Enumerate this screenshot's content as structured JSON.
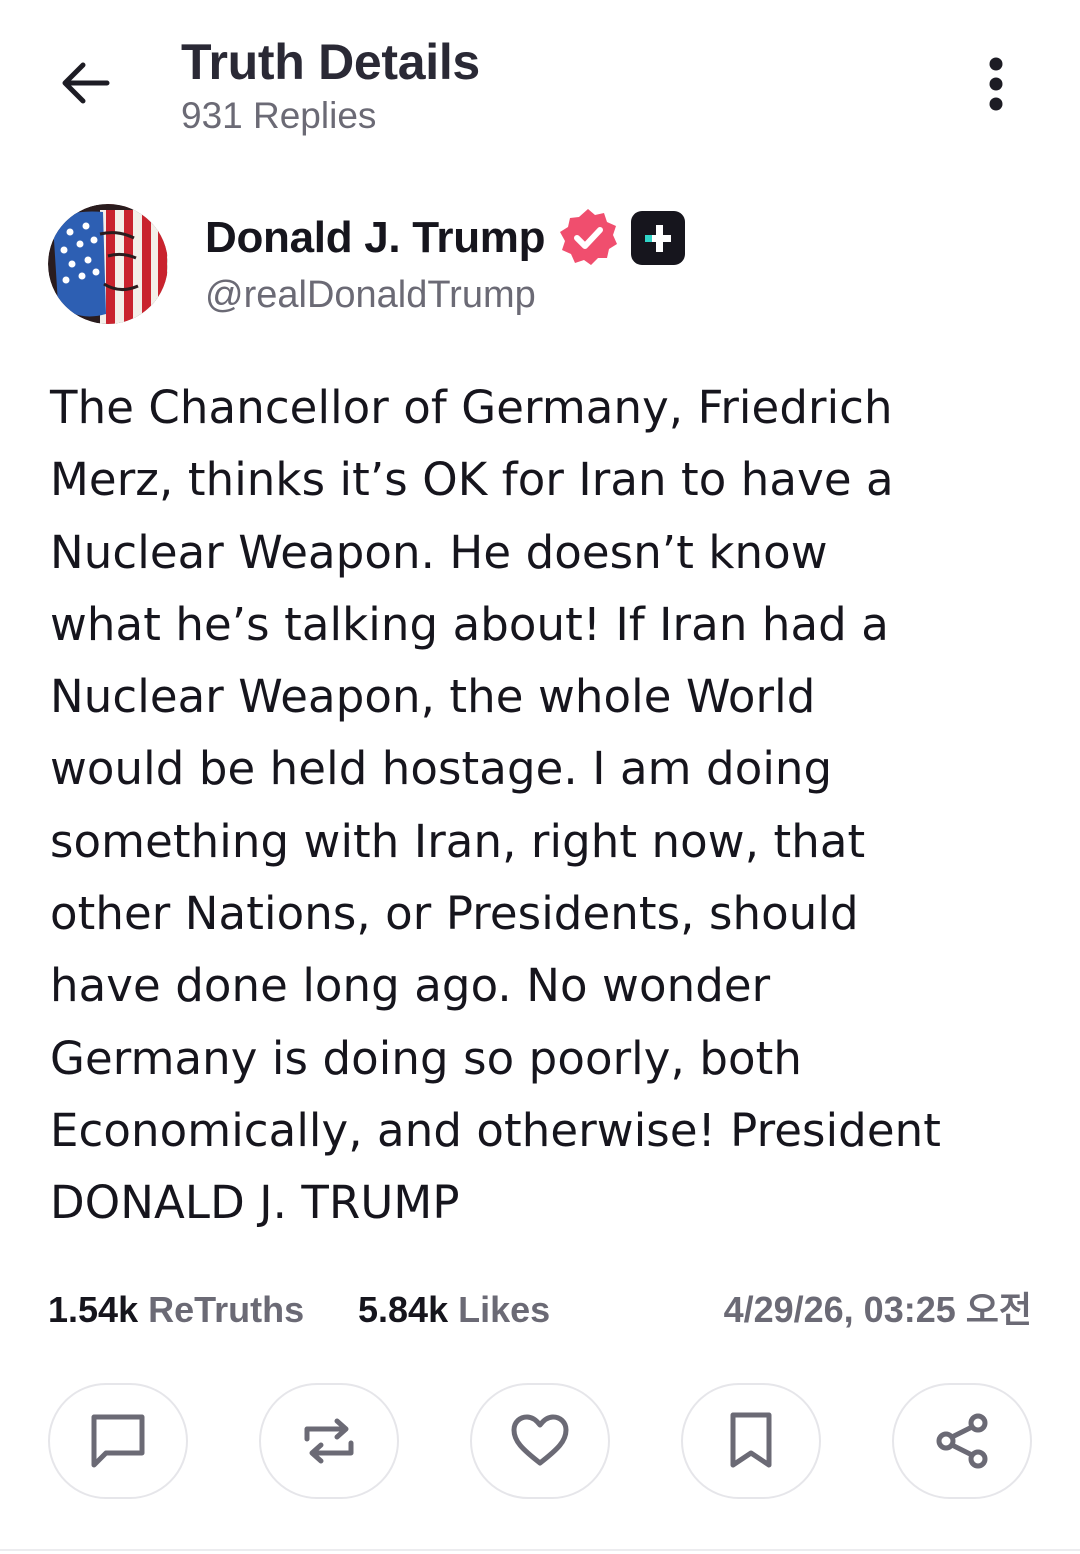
{
  "header": {
    "title": "Truth Details",
    "replies": "931 Replies"
  },
  "author": {
    "display_name": "Donald J. Trump",
    "handle": "@realDonaldTrump",
    "verified_color": "#f04e6e",
    "plus_badge_color": "#16151d",
    "plus_accent_color": "#30d5c8"
  },
  "post": {
    "text": "The Chancellor of Germany, Friedrich\nMerz, thinks it’s OK for Iran to have a\nNuclear Weapon. He doesn’t know\nwhat he’s talking about! If Iran had a\nNuclear Weapon, the whole World\nwould be held hostage. I am doing\nsomething with Iran, right now, that\nother Nations, or Presidents, should\nhave done long ago. No wonder\nGermany is doing so poorly, both\nEconomically, and otherwise! President\nDONALD J. TRUMP"
  },
  "stats": {
    "retruths_count": "1.54k",
    "retruths_label": "ReTruths",
    "likes_count": "5.84k",
    "likes_label": "Likes",
    "timestamp": "4/29/26, 03:25 오전"
  },
  "actions": {
    "icons": [
      "reply-icon",
      "retruth-icon",
      "like-icon",
      "bookmark-icon",
      "share-icon"
    ]
  }
}
